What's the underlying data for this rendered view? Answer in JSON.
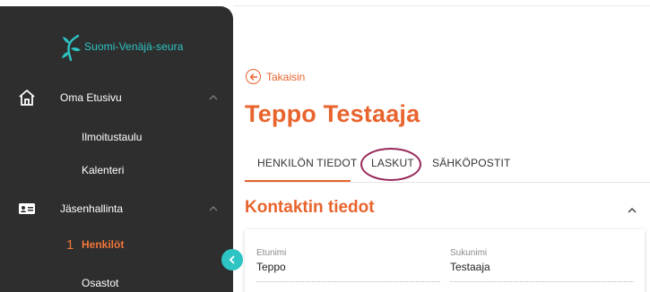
{
  "brand": {
    "name": "Suomi-Venäjä-seura"
  },
  "sidebar": {
    "items": [
      {
        "label": "Oma Etusivu",
        "icon": "home-icon",
        "expanded": true
      },
      {
        "label": "Ilmoitustaulu"
      },
      {
        "label": "Kalenteri"
      },
      {
        "label": "Jäsenhallinta",
        "icon": "id-card-icon",
        "expanded": true
      },
      {
        "label": "Henkilöt",
        "active": true,
        "annotation_number": "1"
      },
      {
        "label": "Osastot"
      }
    ]
  },
  "back": {
    "label": "Takaisin"
  },
  "person": {
    "name": "Teppo Testaaja"
  },
  "tabs": [
    {
      "label": "HENKILÖN TIEDOT",
      "active": true
    },
    {
      "label": "LASKUT",
      "highlighted": true
    },
    {
      "label": "SÄHKÖPOSTIT"
    }
  ],
  "section": {
    "title": "Kontaktin tiedot",
    "expanded": true
  },
  "fields": [
    {
      "label": "Etunimi",
      "value": "Teppo"
    },
    {
      "label": "Sukunimi",
      "value": "Testaaja"
    }
  ],
  "colors": {
    "accent": "#e8642d",
    "sidebar_bg": "#2e2e2e",
    "brand_teal": "#2ec4c4",
    "annotation": "#96285a"
  }
}
